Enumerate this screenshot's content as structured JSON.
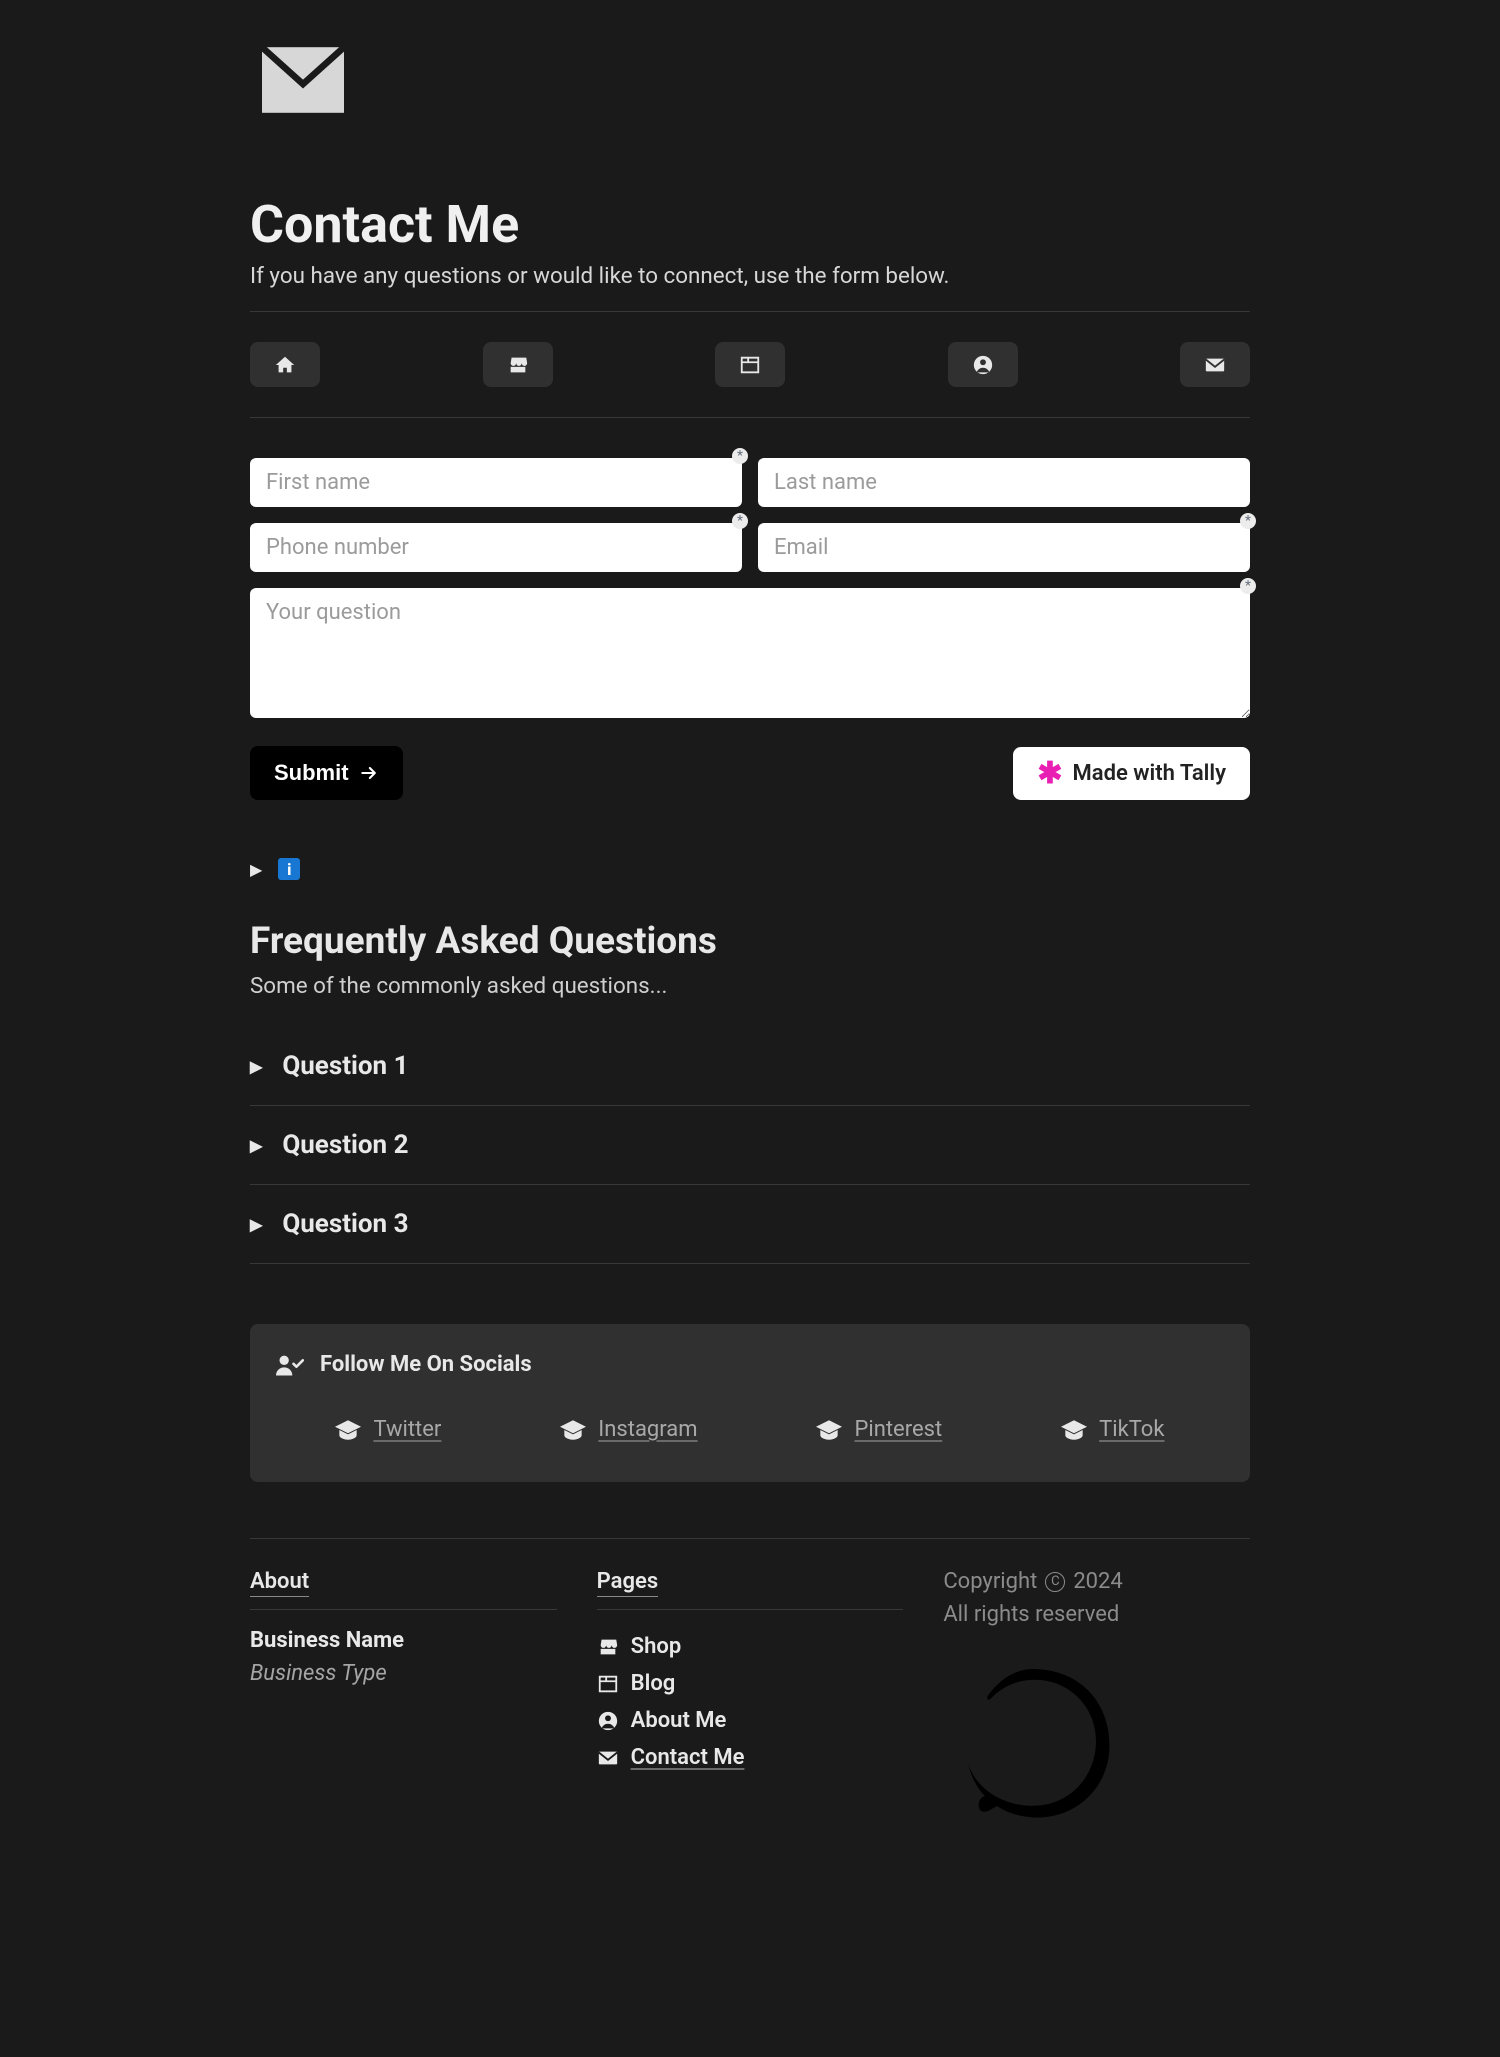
{
  "header": {
    "title": "Contact Me",
    "subtitle": "If you have any questions or would like to connect, use the form below."
  },
  "nav": [
    {
      "name": "home"
    },
    {
      "name": "shop"
    },
    {
      "name": "blog"
    },
    {
      "name": "about"
    },
    {
      "name": "contact"
    }
  ],
  "form": {
    "first_name_ph": "First name",
    "last_name_ph": "Last name",
    "phone_ph": "Phone number",
    "email_ph": "Email",
    "question_ph": "Your question",
    "submit_label": "Submit",
    "tally_label": "Made with Tally"
  },
  "info_badge": "i",
  "faq": {
    "title": "Frequently Asked Questions",
    "subtitle": "Some of the commonly asked questions...",
    "items": [
      "Question 1",
      "Question 2",
      "Question 3"
    ]
  },
  "socials": {
    "heading": "Follow Me On Socials",
    "links": [
      "Twitter",
      "Instagram",
      "Pinterest",
      "TikTok"
    ]
  },
  "footer": {
    "about_heading": "About",
    "business_name": "Business Name",
    "business_type": "Business Type",
    "pages_heading": "Pages",
    "page_links": [
      "Shop",
      "Blog",
      "About Me",
      "Contact Me"
    ],
    "copyright_word": "Copyright",
    "year": "2024",
    "rights": "All rights reserved"
  }
}
